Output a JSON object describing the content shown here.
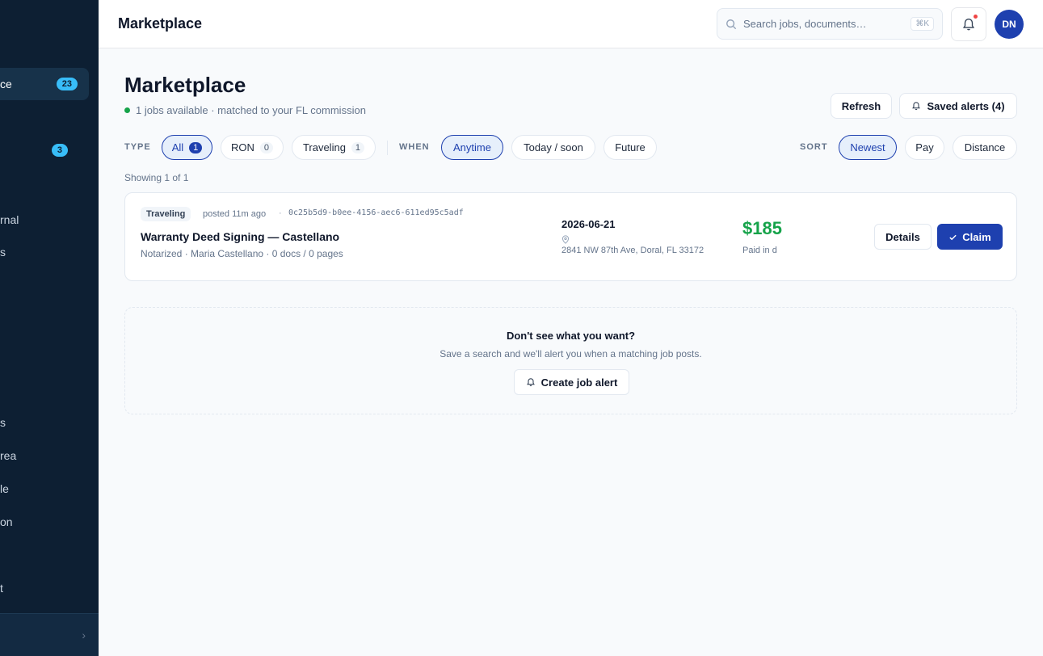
{
  "sidebar": {
    "items": [
      {
        "label": "ce",
        "count": "23",
        "active": true
      },
      {
        "label": "",
        "count": ""
      },
      {
        "label": "",
        "count": "3"
      },
      {
        "label": "rnal",
        "count": ""
      },
      {
        "label": "s",
        "count": ""
      },
      {
        "label": "s",
        "count": ""
      },
      {
        "label": "rea",
        "count": ""
      },
      {
        "label": "le",
        "count": ""
      },
      {
        "label": "on",
        "count": ""
      },
      {
        "label": "t",
        "count": ""
      }
    ],
    "footer_chevron": "›"
  },
  "topbar": {
    "title": "Marketplace",
    "search_placeholder": "Search jobs, documents…",
    "search_shortcut": "⌘K",
    "avatar_initials": "DN"
  },
  "page": {
    "title": "Marketplace",
    "subtitle": "1 jobs available · matched to your FL commission",
    "refresh_label": "Refresh",
    "saved_alerts_label": "Saved alerts (4)"
  },
  "filters": {
    "type_label": "TYPE",
    "type_options": [
      {
        "label": "All",
        "count": "1",
        "selected": true
      },
      {
        "label": "RON",
        "count": "0"
      },
      {
        "label": "Traveling",
        "count": "1"
      }
    ],
    "when_label": "WHEN",
    "when_options": [
      {
        "label": "Anytime",
        "selected": true
      },
      {
        "label": "Today / soon"
      },
      {
        "label": "Future"
      }
    ],
    "sort_label": "SORT",
    "sort_options": [
      {
        "label": "Newest",
        "selected": true
      },
      {
        "label": "Pay"
      },
      {
        "label": "Distance"
      }
    ]
  },
  "results": {
    "showing": "Showing 1 of 1"
  },
  "job": {
    "tag": "Traveling",
    "posted": "posted 11m ago",
    "separator": "·",
    "id": "0c25b5d9-b0ee-4156-aec6-611ed95c5adf",
    "title": "Warranty Deed Signing — Castellano",
    "meta": "Notarized · Maria Castellano · 0 docs / 0 pages",
    "date": "2026-06-21",
    "address": "2841 NW 87th Ave, Doral, FL 33172",
    "pay": "$185",
    "paid_note": "Paid in d",
    "details_label": "Details",
    "claim_label": "Claim"
  },
  "empty_state": {
    "title": "Don't see what you want?",
    "subtitle": "Save a search and we'll alert you when a matching job posts.",
    "button_label": "Create job alert"
  },
  "colors": {
    "sidebar_bg": "#0d1f33",
    "accent": "#1e40af",
    "pay_green": "#16a34a",
    "badge_cyan": "#38bdf8"
  }
}
